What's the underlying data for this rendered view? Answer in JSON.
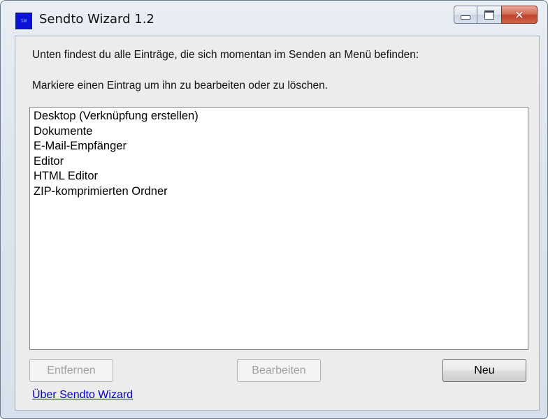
{
  "window": {
    "title": "Sendto Wizard 1.2",
    "icon": "app-icon",
    "caption_buttons": {
      "minimize": "minimize-icon",
      "maximize": "maximize-icon",
      "close": "close-icon"
    }
  },
  "main": {
    "info_line_1": "Unten findest du alle Einträge, die sich momentan im Senden an Menü befinden:",
    "info_line_2": "Markiere einen Eintrag um ihn zu bearbeiten oder zu löschen.",
    "list": {
      "items": [
        {
          "label": "Desktop (Verknüpfung erstellen)"
        },
        {
          "label": "Dokumente"
        },
        {
          "label": "E-Mail-Empfänger"
        },
        {
          "label": "Editor"
        },
        {
          "label": "HTML Editor"
        },
        {
          "label": "ZIP-komprimierten Ordner"
        }
      ]
    },
    "buttons": {
      "remove_label": "Entfernen",
      "edit_label": "Bearbeiten",
      "new_label": "Neu"
    },
    "about_link": "Über Sendto Wizard"
  },
  "colors": {
    "link": "#0000cc",
    "close_button": "#c0432b",
    "app_icon": "#0a12d8"
  }
}
